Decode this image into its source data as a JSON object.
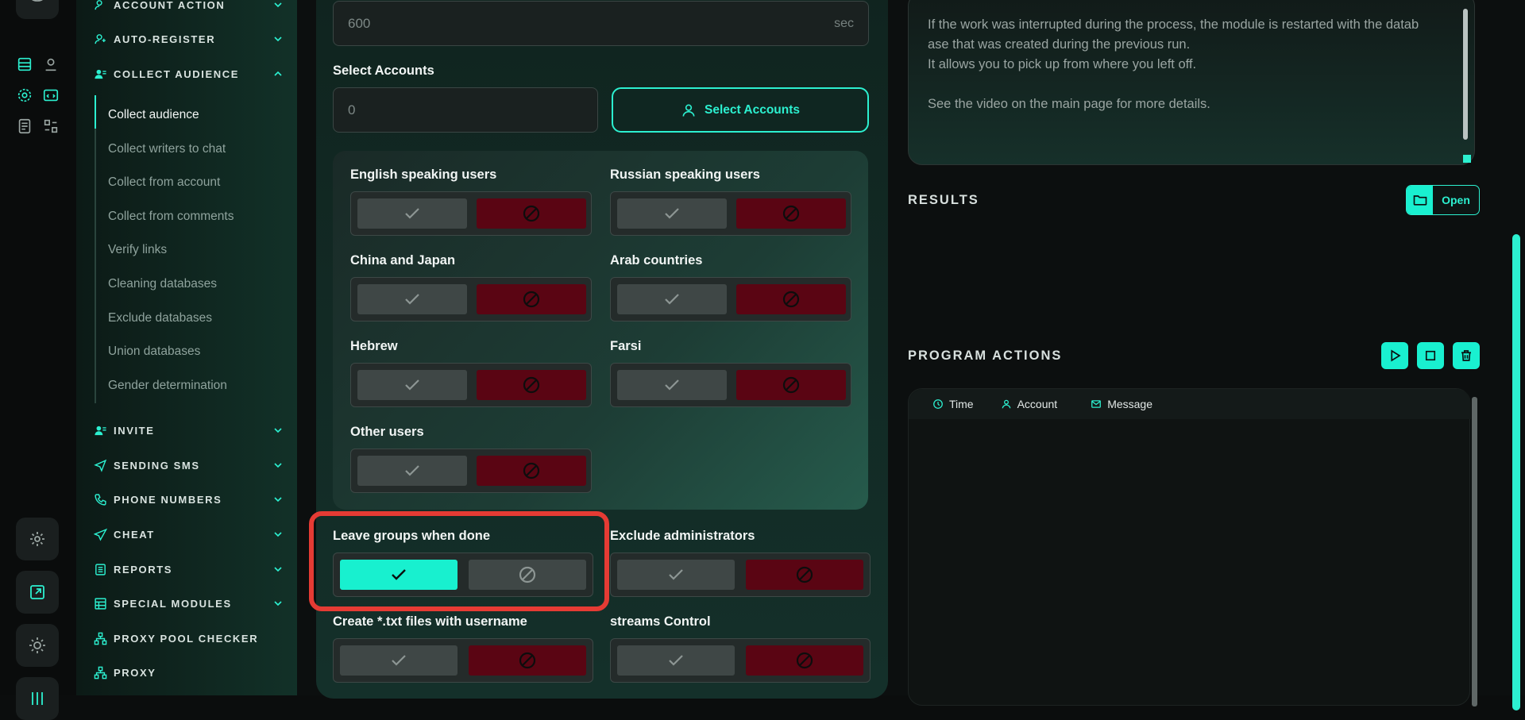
{
  "colors": {
    "accent": "#2cf0d0",
    "danger": "#5a0513",
    "highlight": "#e53b34"
  },
  "sidebar": {
    "sections": [
      {
        "label": "ACCOUNT ACTION",
        "icon": "user-action-icon"
      },
      {
        "label": "AUTO-REGISTER",
        "icon": "user-add-icon"
      },
      {
        "label": "COLLECT AUDIENCE",
        "icon": "users-icon",
        "expanded": true
      },
      {
        "label": "INVITE",
        "icon": "invite-icon"
      },
      {
        "label": "SENDING SMS",
        "icon": "send-icon"
      },
      {
        "label": "PHONE NUMBERS",
        "icon": "phone-icon"
      },
      {
        "label": "CHEAT",
        "icon": "paper-plane-icon"
      },
      {
        "label": "REPORTS",
        "icon": "report-icon"
      },
      {
        "label": "SPECIAL MODULES",
        "icon": "table-icon"
      },
      {
        "label": "PROXY POOL CHECKER",
        "icon": "network-icon"
      },
      {
        "label": "PROXY",
        "icon": "network-icon"
      }
    ],
    "collect_items": [
      "Collect audience",
      "Collect writers to chat",
      "Collect from account",
      "Collect from comments",
      "Verify links",
      "Cleaning databases",
      "Exclude databases",
      "Union databases",
      "Gender determination"
    ]
  },
  "form": {
    "delay_value": "600",
    "delay_unit": "sec",
    "select_accounts_label": "Select Accounts",
    "accounts_count": "0",
    "select_accounts_button": "Select Accounts",
    "languages": [
      {
        "label": "English speaking users"
      },
      {
        "label": "Russian speaking users"
      },
      {
        "label": "China and Japan"
      },
      {
        "label": "Arab countries"
      },
      {
        "label": "Hebrew"
      },
      {
        "label": "Farsi"
      },
      {
        "label": "Other users"
      }
    ],
    "options": [
      {
        "label": "Leave groups when done",
        "enabled": true
      },
      {
        "label": "Exclude administrators",
        "enabled": false
      },
      {
        "label": "Create *.txt files with username",
        "enabled": false
      },
      {
        "label": "streams Control",
        "enabled": false
      }
    ]
  },
  "description": {
    "lines": [
      "If the work was interrupted during the process, the module is restarted with the datab",
      "ase that was created during the previous run.",
      "It allows you to pick up from where you left off.",
      "",
      "See the video on the main page for more details."
    ]
  },
  "results": {
    "title": "RESULTS",
    "open_label": "Open"
  },
  "program_actions": {
    "title": "PROGRAM ACTIONS",
    "columns": [
      {
        "label": "Time",
        "icon": "clock-icon"
      },
      {
        "label": "Account",
        "icon": "user-icon"
      },
      {
        "label": "Message",
        "icon": "mail-icon"
      }
    ]
  }
}
